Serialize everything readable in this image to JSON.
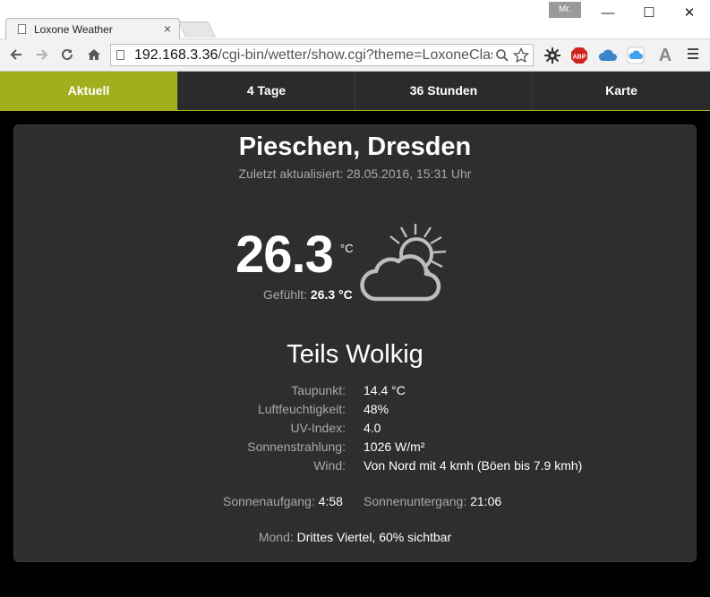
{
  "browser": {
    "tab_title": "Loxone Weather",
    "tab_close": "×",
    "profile": "Mr.",
    "window": {
      "minimize": "—",
      "maximize": "☐",
      "close": "✕"
    },
    "url_host": "192.168.3.36",
    "url_path": "/cgi-bin/wetter/show.cgi?theme=LoxoneClas",
    "extensions": [
      "gear-icon",
      "adblock-icon",
      "cloud-icon",
      "icloud-icon",
      "font-icon",
      "menu-icon"
    ],
    "adblock_label": "ABP",
    "font_label": "A"
  },
  "nav": {
    "tabs": [
      {
        "label": "Aktuell",
        "active": true
      },
      {
        "label": "4 Tage",
        "active": false
      },
      {
        "label": "36 Stunden",
        "active": false
      },
      {
        "label": "Karte",
        "active": false
      }
    ]
  },
  "weather": {
    "location": "Pieschen, Dresden",
    "updated": "Zuletzt aktualisiert: 28.05.2016, 15:31 Uhr",
    "temperature": "26.3",
    "unit": "°C",
    "feels_label": "Gefühlt:",
    "feels_value": "26.3 °C",
    "condition": "Teils Wolkig",
    "icon": "partly-cloudy-icon",
    "details": [
      {
        "label": "Taupunkt:",
        "value": "14.4 °C"
      },
      {
        "label": "Luftfeuchtigkeit:",
        "value": "48%"
      },
      {
        "label": "UV-Index:",
        "value": "4.0"
      },
      {
        "label": "Sonnenstrahlung:",
        "value": "1026 W/m²"
      },
      {
        "label": "Wind:",
        "value": "Von Nord mit 4 kmh (Böen bis 7.9 kmh)"
      }
    ],
    "sunrise_label": "Sonnenaufgang:",
    "sunrise": "4:58",
    "sunset_label": "Sonnenuntergang:",
    "sunset": "21:06",
    "moon_label": "Mond:",
    "moon": "Drittes Viertel, 60% sichtbar"
  },
  "colors": {
    "accent": "#a2ae1c",
    "card": "#2e2e2e",
    "nav": "#2b2b2b",
    "background": "#000000"
  }
}
